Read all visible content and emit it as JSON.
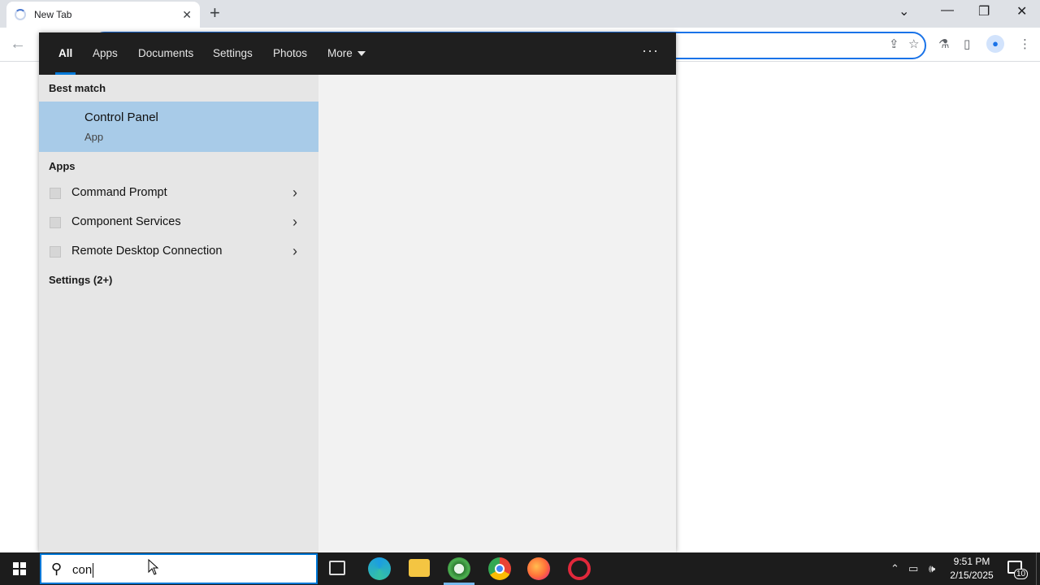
{
  "browser": {
    "tab_title": "New Tab",
    "tab_close_icon": "close-icon",
    "new_tab_icon": "plus-icon",
    "window_controls": [
      "chevron-down-icon",
      "minimize-icon",
      "restore-icon",
      "close-icon"
    ],
    "toolbar_icons": [
      "share-icon",
      "star-icon",
      "labs-icon",
      "side-panel-icon",
      "profile-icon",
      "menu-icon"
    ]
  },
  "search_panel": {
    "filters": [
      {
        "label": "All",
        "active": true
      },
      {
        "label": "Apps",
        "active": false
      },
      {
        "label": "Documents",
        "active": false
      },
      {
        "label": "Settings",
        "active": false
      },
      {
        "label": "Photos",
        "active": false
      },
      {
        "label": "More",
        "active": false
      }
    ],
    "options_icon": "more-options-icon",
    "best_match_heading": "Best match",
    "best_match": {
      "title": "Control Panel",
      "subtitle": "App"
    },
    "apps_heading": "Apps",
    "apps": [
      {
        "label": "Command Prompt"
      },
      {
        "label": "Component Services"
      },
      {
        "label": "Remote Desktop Connection"
      }
    ],
    "settings_heading": "Settings (2+)"
  },
  "taskbar": {
    "search_query": "con",
    "apps": [
      "task-view-icon",
      "edge-icon",
      "file-explorer-icon",
      "edge-dev-icon",
      "chrome-icon",
      "firefox-icon",
      "opera-icon"
    ],
    "clock_time": "9:51 PM",
    "clock_date": "2/15/2025",
    "notification_count": "10"
  },
  "colors": {
    "accent": "#0078d7",
    "selection": "#a8cbe8",
    "filter_bar": "#1f1f1f",
    "taskbar": "#1c1c1c"
  }
}
